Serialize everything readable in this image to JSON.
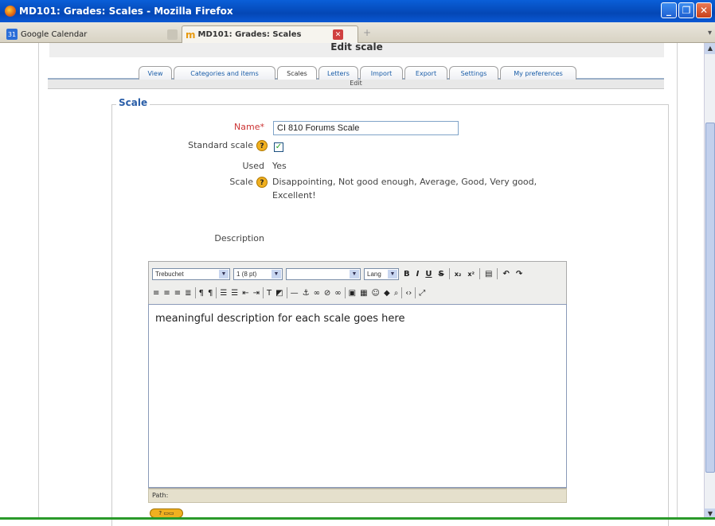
{
  "window": {
    "title": "MD101: Grades: Scales - Mozilla Firefox"
  },
  "browser_tabs": [
    {
      "label": "Google Calendar",
      "icon": "calendar-icon"
    },
    {
      "label": "MD101: Grades: Scales",
      "icon": "moodle-icon",
      "active": true
    }
  ],
  "page": {
    "heading": "Edit scale",
    "tabs": [
      "View",
      "Categories and items",
      "Scales",
      "Letters",
      "Import",
      "Export",
      "Settings",
      "My preferences"
    ],
    "active_tab": "Scales",
    "subtab": "Edit"
  },
  "form": {
    "legend": "Scale",
    "name_label": "Name",
    "name_required_mark": "*",
    "name_value": "CI 810 Forums Scale",
    "standard_label": "Standard scale",
    "standard_checked": true,
    "used_label": "Used",
    "used_value": "Yes",
    "scale_label": "Scale",
    "scale_value": "Disappointing, Not good enough, Average, Good, Very good, Excellent!",
    "description_label": "Description"
  },
  "editor": {
    "font": "Trebuchet",
    "size": "1 (8 pt)",
    "style": "",
    "lang": "Lang",
    "content": "meaningful description for each scale goes here",
    "path_label": "Path:"
  },
  "colors": {
    "accent": "#2a5ea8",
    "required": "#cc3333",
    "titlebar": "#0447b5"
  }
}
